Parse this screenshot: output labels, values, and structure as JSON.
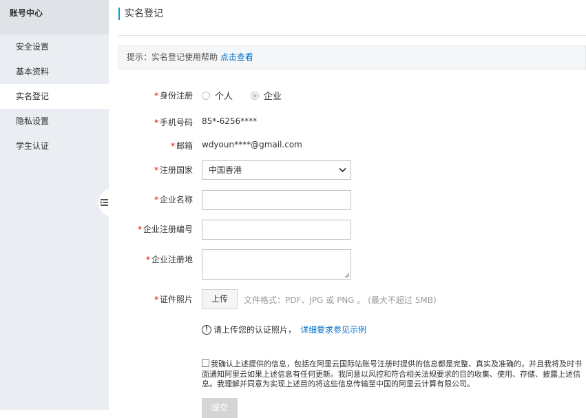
{
  "sidebar": {
    "title": "账号中心",
    "items": [
      {
        "label": "安全设置"
      },
      {
        "label": "基本资料"
      },
      {
        "label": "实名登记"
      },
      {
        "label": "隐私设置"
      },
      {
        "label": "学生认证"
      }
    ]
  },
  "page": {
    "title": "实名登记",
    "tip_prefix": "提示：实名登记使用帮助",
    "tip_link": "点击查看"
  },
  "form": {
    "identity": {
      "label": "身份注册",
      "options": [
        "个人",
        "企业"
      ],
      "selected": "企业"
    },
    "phone": {
      "label": "手机号码",
      "value": "85*-6256****"
    },
    "email": {
      "label": "邮箱",
      "value": "wdyoun****@gmail.com"
    },
    "country": {
      "label": "注册国家",
      "value": "中国香港"
    },
    "company_name": {
      "label": "企业名称",
      "value": ""
    },
    "company_reg_no": {
      "label": "企业注册编号",
      "value": ""
    },
    "company_address": {
      "label": "企业注册地",
      "value": ""
    },
    "photo": {
      "label": "证件照片",
      "upload_label": "上传",
      "hint": "文件格式：PDF、JPG 或 PNG 。 (最大不超过 5MB)"
    },
    "warning": {
      "icon": "exclamation-icon",
      "text": "请上传您的认证照片，",
      "link": "详细要求参见示例"
    },
    "agreement": "我确认上述提供的信息，包括在阿里云国际站账号注册时提供的信息都是完整、真实及准确的，并且我将及时书面通知阿里云如果上述信息有任何更新。我同意以风控和符合相关法规要求的目的收集、使用、存储、披露上述信息。我理解并同意为实现上述目的将这些信息传输至中国的阿里云计算有限公司。",
    "submit": "提交"
  },
  "colors": {
    "accent": "#00a2ca",
    "link": "#0070cc",
    "required": "#e00000",
    "sidebar_bg": "#eaedf1"
  }
}
